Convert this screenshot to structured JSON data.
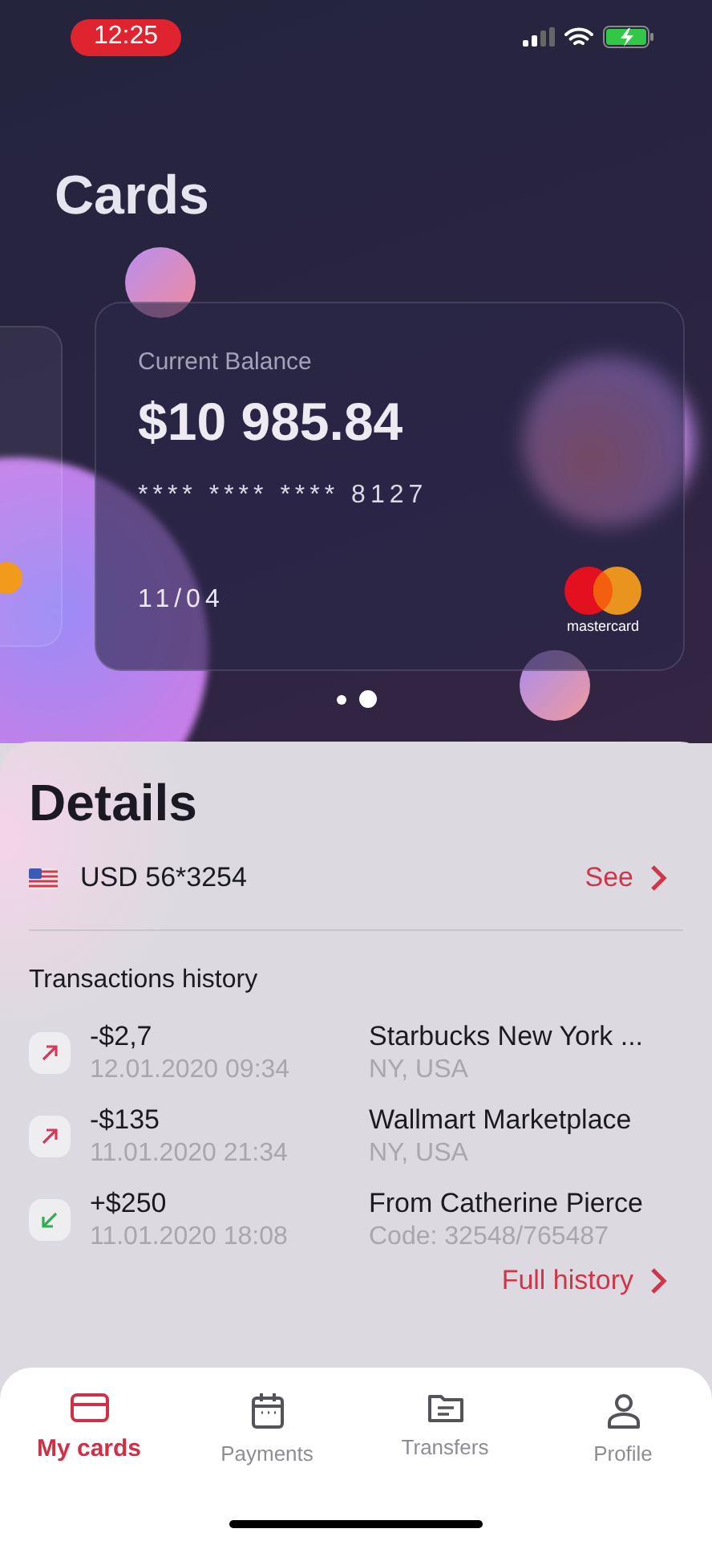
{
  "status_bar": {
    "time": "12:25"
  },
  "title": "Cards",
  "card": {
    "label": "Current Balance",
    "balance": "$10 985.84",
    "number": "**** **** **** 8127",
    "expiry": "11/04",
    "brand": "mastercard"
  },
  "pager": [
    {
      "selected": false
    },
    {
      "selected": true
    }
  ],
  "details": {
    "title": "Details",
    "account": "USD 56*3254",
    "see": "See",
    "history_title": "Transactions history",
    "transactions": [
      {
        "kind": "out",
        "amount": "-$2,7",
        "date": "12.01.2020 09:34",
        "name": "Starbucks New York ...",
        "detail": "NY, USA"
      },
      {
        "kind": "out",
        "amount": "-$135",
        "date": "11.01.2020 21:34",
        "name": "Wallmart Marketplace",
        "detail": "NY, USA"
      },
      {
        "kind": "in",
        "amount": "+$250",
        "date": "11.01.2020 18:08",
        "name": "From Catherine Pierce",
        "detail": "Code: 32548/765487"
      }
    ],
    "full_history": "Full history"
  },
  "nav": [
    {
      "kind": "cards",
      "label": "My cards",
      "selected": true
    },
    {
      "kind": "calendar",
      "label": "Payments",
      "selected": false
    },
    {
      "kind": "folder",
      "label": "Transfers",
      "selected": false
    },
    {
      "kind": "person",
      "label": "Profile",
      "selected": false
    }
  ]
}
